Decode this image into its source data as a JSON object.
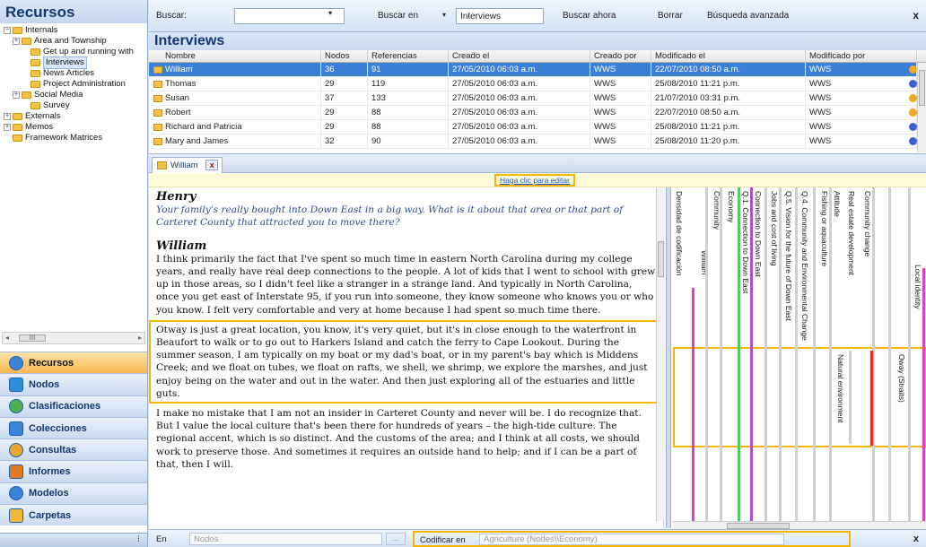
{
  "nav": {
    "title": "Recursos",
    "tree": [
      {
        "label": "Internals",
        "level": 0,
        "exp": "−"
      },
      {
        "label": "Area and Township",
        "level": 1,
        "exp": "+"
      },
      {
        "label": "Get up and running with",
        "level": 2,
        "exp": ""
      },
      {
        "label": "Interviews",
        "level": 2,
        "exp": "",
        "selected": true
      },
      {
        "label": "News Articles",
        "level": 2,
        "exp": ""
      },
      {
        "label": "Project Administration",
        "level": 2,
        "exp": ""
      },
      {
        "label": "Social Media",
        "level": 1,
        "exp": "+"
      },
      {
        "label": "Survey",
        "level": 2,
        "exp": ""
      },
      {
        "label": "Externals",
        "level": 0,
        "exp": "+"
      },
      {
        "label": "Memos",
        "level": 0,
        "exp": "+"
      },
      {
        "label": "Framework Matrices",
        "level": 0,
        "exp": ""
      }
    ],
    "buttons": [
      "Recursos",
      "Nodos",
      "Clasificaciones",
      "Colecciones",
      "Consultas",
      "Informes",
      "Modelos",
      "Carpetas"
    ]
  },
  "search": {
    "label": "Buscar:",
    "search_in_label": "Buscar en",
    "search_in_value": "Interviews",
    "search_now": "Buscar ahora",
    "clear": "Borrar",
    "advanced": "Búsqueda avanzada",
    "close": "x"
  },
  "list": {
    "title": "Interviews",
    "headers": [
      "Nombre",
      "Nodos",
      "Referencias",
      "Creado el",
      "Creado por",
      "Modificado el",
      "Modificado por"
    ],
    "rows": [
      {
        "name": "William",
        "nodes": "36",
        "refs": "91",
        "created": "27/05/2010 06:03 a.m.",
        "created_by": "WWS",
        "modified": "22/07/2010 08:50 a.m.",
        "modified_by": "WWS",
        "dot": "#f3a81e"
      },
      {
        "name": "Thomas",
        "nodes": "29",
        "refs": "119",
        "created": "27/05/2010 06:03 a.m.",
        "created_by": "WWS",
        "modified": "25/08/2010 11:21 p.m.",
        "modified_by": "WWS",
        "dot": "#3d5fd9"
      },
      {
        "name": "Susan",
        "nodes": "37",
        "refs": "133",
        "created": "27/05/2010 06:03 a.m.",
        "created_by": "WWS",
        "modified": "21/07/2010 03:31 p.m.",
        "modified_by": "WWS",
        "dot": "#f3a81e"
      },
      {
        "name": "Robert",
        "nodes": "29",
        "refs": "88",
        "created": "27/05/2010 06:03 a.m.",
        "created_by": "WWS",
        "modified": "22/07/2010 08:50 a.m.",
        "modified_by": "WWS",
        "dot": "#f3a81e"
      },
      {
        "name": "Richard and Patricia",
        "nodes": "29",
        "refs": "88",
        "created": "27/05/2010 06:03 a.m.",
        "created_by": "WWS",
        "modified": "25/08/2010 11:21 p.m.",
        "modified_by": "WWS",
        "dot": "#3d5fd9"
      },
      {
        "name": "Mary and James",
        "nodes": "32",
        "refs": "90",
        "created": "27/05/2010 06:03 a.m.",
        "created_by": "WWS",
        "modified": "25/08/2010 11:20 p.m.",
        "modified_by": "WWS",
        "dot": "#3d5fd9"
      }
    ]
  },
  "detail": {
    "tab_label": "William",
    "tab_close": "x",
    "edit_link": "Haga clic para editar",
    "speaker1": "Henry",
    "question": "Your family's really bought into Down East in a big way. What is it about that area or that part of Carteret County that attracted you to move there?",
    "speaker2": "William",
    "para1": "I think primarily the fact that I've spent so much time in eastern North Carolina during my college years, and really have real deep connections to the people. A lot of kids that I went to school with grew up in those areas, so I didn't feel like a stranger in a strange land. And typically in North Carolina, once you get east of Interstate 95, if you run into someone, they know someone who knows you or who you know. I felt very comfortable and very at home because I had spent so much time there.",
    "para2": "Otway is just a great location, you know, it's very quiet, but it's in close enough to the waterfront in Beaufort to walk or to go out to Harkers Island and catch the ferry to Cape Lookout.  During the summer season, I am typically on my boat or my dad's boat, or in my parent's bay which is Middens Creek; and we float on tubes, we float on rafts, we shell, we shrimp, we explore the marshes, and just enjoy being on the water and out in the water. And then just exploring all of the estuaries and little guts.",
    "para3": "I make no mistake that I am not an insider in Carteret County and never will be. I do recognize that. But I value the local culture that's been there for hundreds of years – the high-tide culture. The regional accent, which is so distinct. And the customs of the area; and I think at all costs, we should work to preserve those. And sometimes it requires an outside hand to help; and if I can be a part of that, then I will."
  },
  "stripes": {
    "labels": [
      "Densidad de codificación",
      "William",
      "Community",
      "Economy",
      "Q.1. Connection to Down East",
      "Connection to Down East",
      "Jobs and cost of living",
      "Q.5. Vision for the future of Down East",
      "Q.4. Community and Environmental Change",
      "Fishing or aquaculture",
      "Attitude",
      "Real estate development",
      "Community change",
      "Natural environment",
      "Oway (Straits)",
      "Local identity"
    ]
  },
  "bottom": {
    "in_label": "En",
    "nodes_placeholder": "Nodos",
    "dots": "...",
    "code_in_label": "Codificar en",
    "code_in_value": "Agriculture (Nodes\\\\Economy)",
    "close": "x"
  }
}
